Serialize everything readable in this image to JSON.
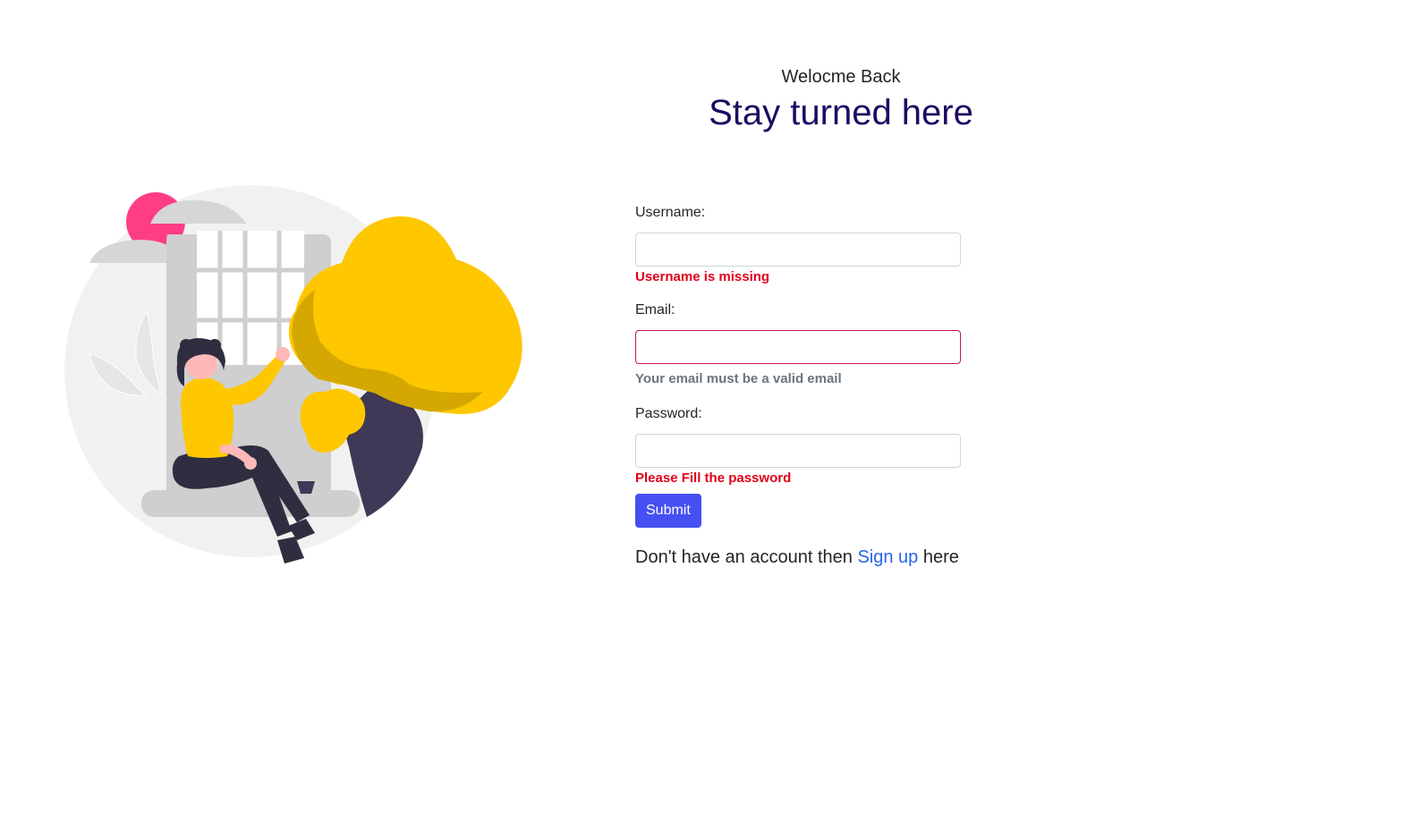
{
  "header": {
    "welcome": "Welocme Back",
    "headline": "Stay turned here"
  },
  "illustration": {
    "icon": "woman-relaxing-by-window-illustration"
  },
  "form": {
    "username": {
      "label": "Username:",
      "value": "",
      "error": "Username is missing"
    },
    "email": {
      "label": "Email:",
      "value": "",
      "hint": "Your email must be a valid email"
    },
    "password": {
      "label": "Password:",
      "value": "",
      "error": "Please Fill the password"
    },
    "submit_label": "Submit"
  },
  "signup": {
    "prefix": "Don't have an account then",
    "link_text": "Sign up",
    "suffix": "here"
  },
  "colors": {
    "headline": "#1e0963",
    "submit_bg": "#4650f2",
    "error": "#e0001a",
    "invalid_border": "#c2185b",
    "link": "#2563eb",
    "illustration_yellow": "#ffc700",
    "illustration_pink": "#ff3d84",
    "illustration_dark": "#3f3856"
  }
}
